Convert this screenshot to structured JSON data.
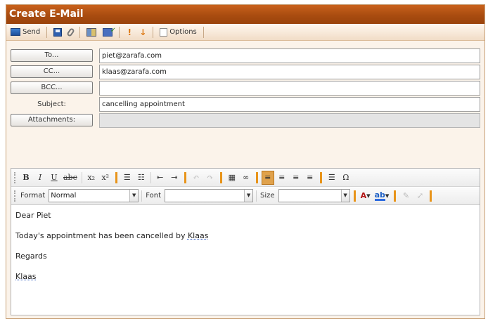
{
  "window": {
    "title": "Create E-Mail"
  },
  "toolbar": {
    "send_label": "Send",
    "options_label": "Options",
    "icons": [
      "send-icon",
      "save-icon",
      "attach-icon",
      "address-book-icon",
      "spellcheck-icon",
      "high-priority-icon",
      "low-priority-icon",
      "options-icon"
    ]
  },
  "header": {
    "to_label": "To...",
    "to_value": "piet@zarafa.com",
    "cc_label": "CC...",
    "cc_value": "klaas@zarafa.com",
    "bcc_label": "BCC...",
    "bcc_value": "",
    "subject_label": "Subject:",
    "subject_value": "cancelling appointment",
    "attachments_label": "Attachments:",
    "attachments_value": ""
  },
  "editor": {
    "format_label": "Format",
    "format_value": "Normal",
    "font_label": "Font",
    "font_value": "",
    "size_label": "Size",
    "size_value": "",
    "body": {
      "greeting": "Dear Piet",
      "line1_prefix": "Today's appointment has been cancelled by ",
      "line1_name": "Klaas",
      "regards": "Regards",
      "signature": "Klaas"
    }
  },
  "colors": {
    "title_bar": "#a94c10",
    "active_button": "#e0a24c",
    "accent_bar": "#e8941a"
  }
}
